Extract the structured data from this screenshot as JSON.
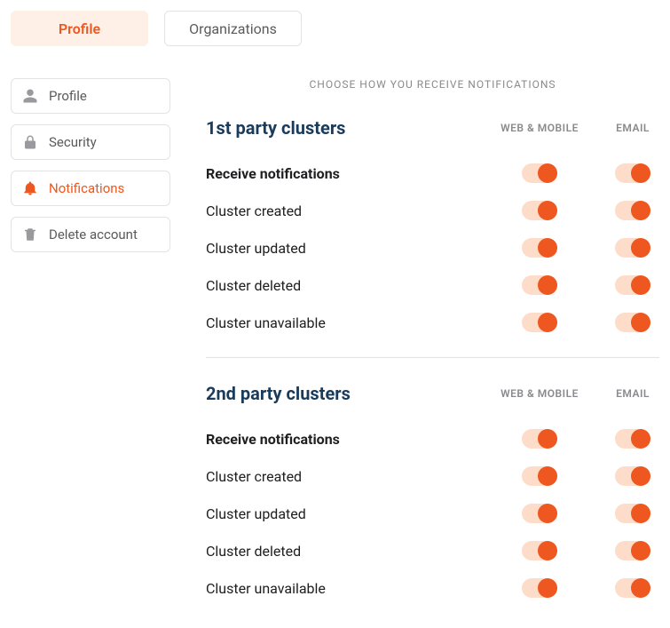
{
  "colors": {
    "accent": "#ee571f"
  },
  "topTabs": [
    {
      "label": "Profile",
      "active": true
    },
    {
      "label": "Organizations",
      "active": false
    }
  ],
  "sidebar": [
    {
      "icon": "user",
      "label": "Profile",
      "active": false
    },
    {
      "icon": "lock",
      "label": "Security",
      "active": false
    },
    {
      "icon": "bell",
      "label": "Notifications",
      "active": true
    },
    {
      "icon": "trash",
      "label": "Delete account",
      "active": false
    }
  ],
  "main": {
    "subtitle": "CHOOSE HOW YOU RECEIVE NOTIFICATIONS",
    "columns": {
      "web": "WEB & MOBILE",
      "email": "EMAIL"
    },
    "groups": [
      {
        "title": "1st party clusters",
        "rows": [
          {
            "label": "Receive notifications",
            "bold": true,
            "web": true,
            "email": true
          },
          {
            "label": "Cluster created",
            "bold": false,
            "web": true,
            "email": true
          },
          {
            "label": "Cluster updated",
            "bold": false,
            "web": true,
            "email": true
          },
          {
            "label": "Cluster deleted",
            "bold": false,
            "web": true,
            "email": true
          },
          {
            "label": "Cluster unavailable",
            "bold": false,
            "web": true,
            "email": true
          }
        ]
      },
      {
        "title": "2nd party clusters",
        "rows": [
          {
            "label": "Receive notifications",
            "bold": true,
            "web": true,
            "email": true
          },
          {
            "label": "Cluster created",
            "bold": false,
            "web": true,
            "email": true
          },
          {
            "label": "Cluster updated",
            "bold": false,
            "web": true,
            "email": true
          },
          {
            "label": "Cluster deleted",
            "bold": false,
            "web": true,
            "email": true
          },
          {
            "label": "Cluster unavailable",
            "bold": false,
            "web": true,
            "email": true
          }
        ]
      }
    ]
  }
}
